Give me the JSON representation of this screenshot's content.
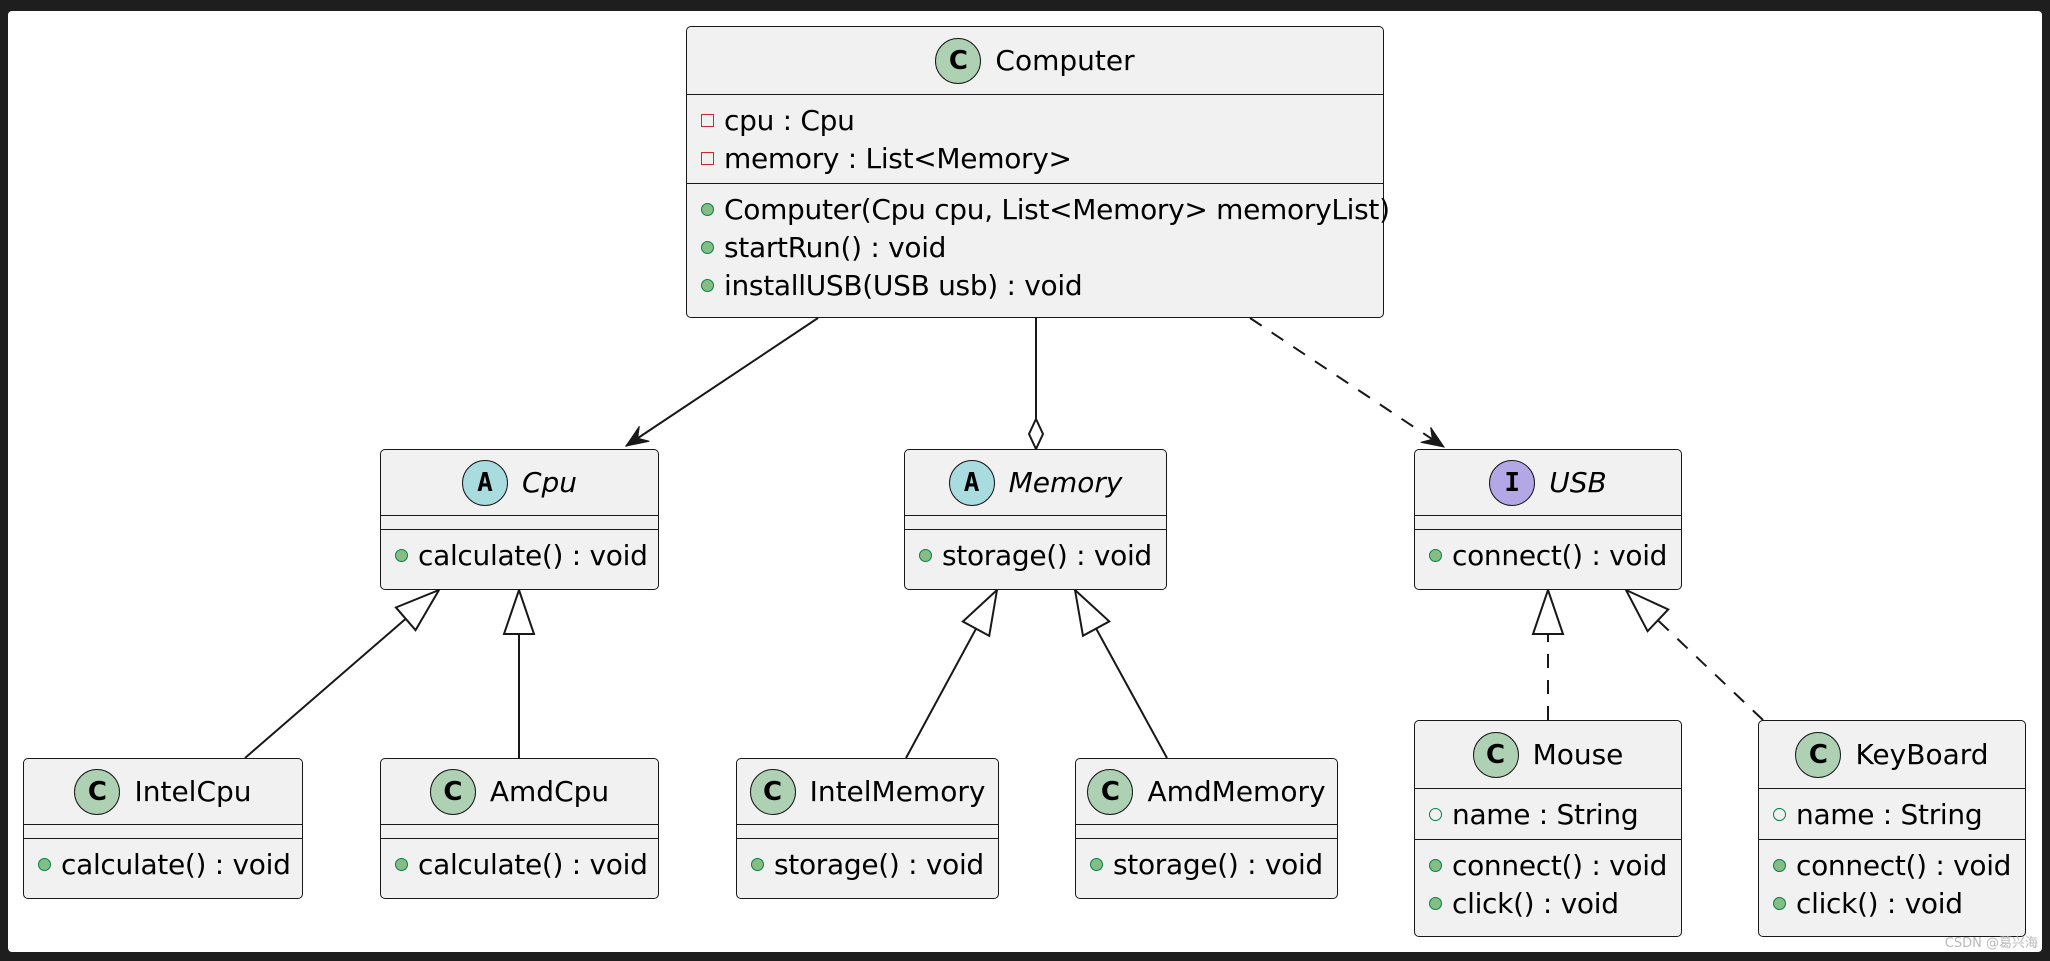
{
  "diagram": {
    "type": "UML class diagram",
    "classes": [
      {
        "id": "computer",
        "kind": "class",
        "badge": "C",
        "name": "Computer",
        "italic": false,
        "attributes": [
          {
            "visibility": "private",
            "text": "cpu : Cpu"
          },
          {
            "visibility": "private",
            "text": "memory : List<Memory>"
          }
        ],
        "methods": [
          {
            "visibility": "public",
            "text": "Computer(Cpu cpu, List<Memory> memoryList)"
          },
          {
            "visibility": "public",
            "text": "startRun() : void"
          },
          {
            "visibility": "public",
            "text": "installUSB(USB usb) : void"
          }
        ]
      },
      {
        "id": "cpu",
        "kind": "abstract",
        "badge": "A",
        "name": "Cpu",
        "italic": true,
        "attributes": [],
        "methods": [
          {
            "visibility": "public",
            "text": "calculate() : void"
          }
        ]
      },
      {
        "id": "memory",
        "kind": "abstract",
        "badge": "A",
        "name": "Memory",
        "italic": true,
        "attributes": [],
        "methods": [
          {
            "visibility": "public",
            "text": "storage() : void"
          }
        ]
      },
      {
        "id": "usb",
        "kind": "interface",
        "badge": "I",
        "name": "USB",
        "italic": true,
        "attributes": [],
        "methods": [
          {
            "visibility": "public",
            "text": "connect() : void"
          }
        ]
      },
      {
        "id": "intelcpu",
        "kind": "class",
        "badge": "C",
        "name": "IntelCpu",
        "italic": false,
        "attributes": [],
        "methods": [
          {
            "visibility": "public",
            "text": "calculate() : void"
          }
        ]
      },
      {
        "id": "amdcpu",
        "kind": "class",
        "badge": "C",
        "name": "AmdCpu",
        "italic": false,
        "attributes": [],
        "methods": [
          {
            "visibility": "public",
            "text": "calculate() : void"
          }
        ]
      },
      {
        "id": "intelmemory",
        "kind": "class",
        "badge": "C",
        "name": "IntelMemory",
        "italic": false,
        "attributes": [],
        "methods": [
          {
            "visibility": "public",
            "text": "storage() : void"
          }
        ]
      },
      {
        "id": "amdmemory",
        "kind": "class",
        "badge": "C",
        "name": "AmdMemory",
        "italic": false,
        "attributes": [],
        "methods": [
          {
            "visibility": "public",
            "text": "storage() : void"
          }
        ]
      },
      {
        "id": "mouse",
        "kind": "class",
        "badge": "C",
        "name": "Mouse",
        "italic": false,
        "attributes": [
          {
            "visibility": "public-field",
            "text": "name : String"
          }
        ],
        "methods": [
          {
            "visibility": "public",
            "text": "connect() : void"
          },
          {
            "visibility": "public",
            "text": "click() : void"
          }
        ]
      },
      {
        "id": "keyboard",
        "kind": "class",
        "badge": "C",
        "name": "KeyBoard",
        "italic": false,
        "attributes": [
          {
            "visibility": "public-field",
            "text": "name : String"
          }
        ],
        "methods": [
          {
            "visibility": "public",
            "text": "connect() : void"
          },
          {
            "visibility": "public",
            "text": "click() : void"
          }
        ]
      }
    ],
    "relations": [
      {
        "from": "computer",
        "to": "cpu",
        "type": "association",
        "style": "solid",
        "head": "open-arrow"
      },
      {
        "from": "computer",
        "to": "memory",
        "type": "aggregation",
        "style": "solid",
        "head": "hollow-diamond"
      },
      {
        "from": "computer",
        "to": "usb",
        "type": "dependency",
        "style": "dashed",
        "head": "open-arrow"
      },
      {
        "from": "intelcpu",
        "to": "cpu",
        "type": "generalization",
        "style": "solid",
        "head": "hollow-triangle"
      },
      {
        "from": "amdcpu",
        "to": "cpu",
        "type": "generalization",
        "style": "solid",
        "head": "hollow-triangle"
      },
      {
        "from": "intelmemory",
        "to": "memory",
        "type": "generalization",
        "style": "solid",
        "head": "hollow-triangle"
      },
      {
        "from": "amdmemory",
        "to": "memory",
        "type": "generalization",
        "style": "solid",
        "head": "hollow-triangle"
      },
      {
        "from": "mouse",
        "to": "usb",
        "type": "realization",
        "style": "dashed",
        "head": "hollow-triangle"
      },
      {
        "from": "keyboard",
        "to": "usb",
        "type": "realization",
        "style": "dashed",
        "head": "hollow-triangle"
      }
    ]
  },
  "colors": {
    "box_fill": "#f1f1f1",
    "border": "#181818",
    "class_badge": "#add1b2",
    "abstract_badge": "#a9dcdf",
    "interface_badge": "#b4a7e5",
    "private_marker": "#c82930",
    "public_marker": "#038048"
  },
  "watermark": "CSDN @葛兴海"
}
